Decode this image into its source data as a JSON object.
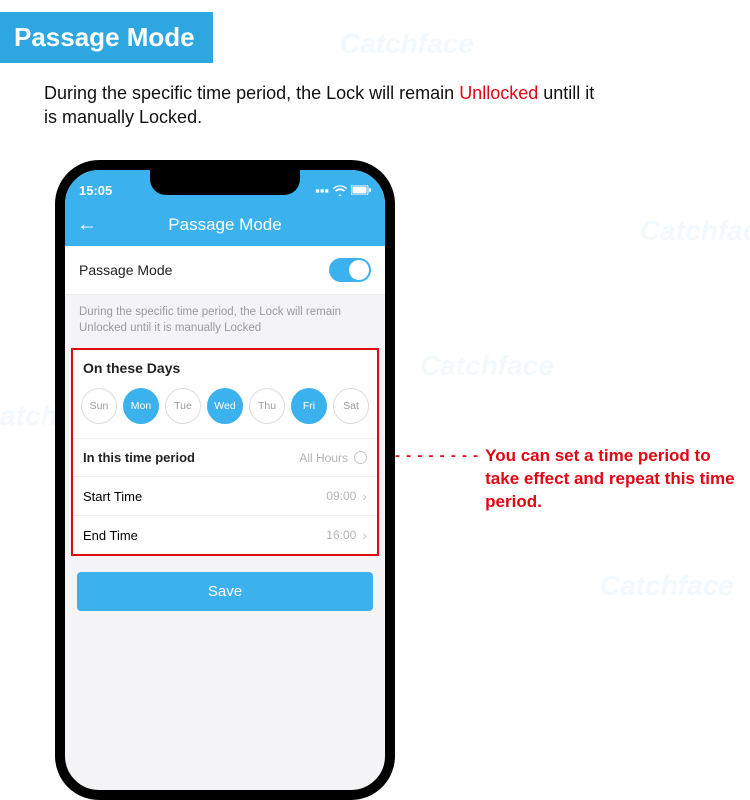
{
  "watermark": "Catchface",
  "heading": "Passage Mode",
  "description_pre": "During the specific time period, the Lock will remain ",
  "description_highlight": "Unllocked",
  "description_post": " untill it is manually Locked.",
  "callout": "You can set a time period to take effect and repeat this time period.",
  "phone": {
    "time": "15:05",
    "signal_icons": "▮▮▮",
    "app_title": "Passage Mode",
    "toggle_label": "Passage Mode",
    "note": "During the specific time period, the Lock will remain Unlocked until it is manually Locked",
    "days_heading": "On these Days",
    "days": [
      {
        "label": "Sun",
        "selected": false
      },
      {
        "label": "Mon",
        "selected": true
      },
      {
        "label": "Tue",
        "selected": false
      },
      {
        "label": "Wed",
        "selected": true
      },
      {
        "label": "Thu",
        "selected": false
      },
      {
        "label": "Fri",
        "selected": true
      },
      {
        "label": "Sat",
        "selected": false
      }
    ],
    "period_label": "In this time period",
    "period_mode": "All Hours",
    "start_label": "Start Time",
    "start_value": "09:00",
    "end_label": "End Time",
    "end_value": "16:00",
    "save_label": "Save"
  }
}
